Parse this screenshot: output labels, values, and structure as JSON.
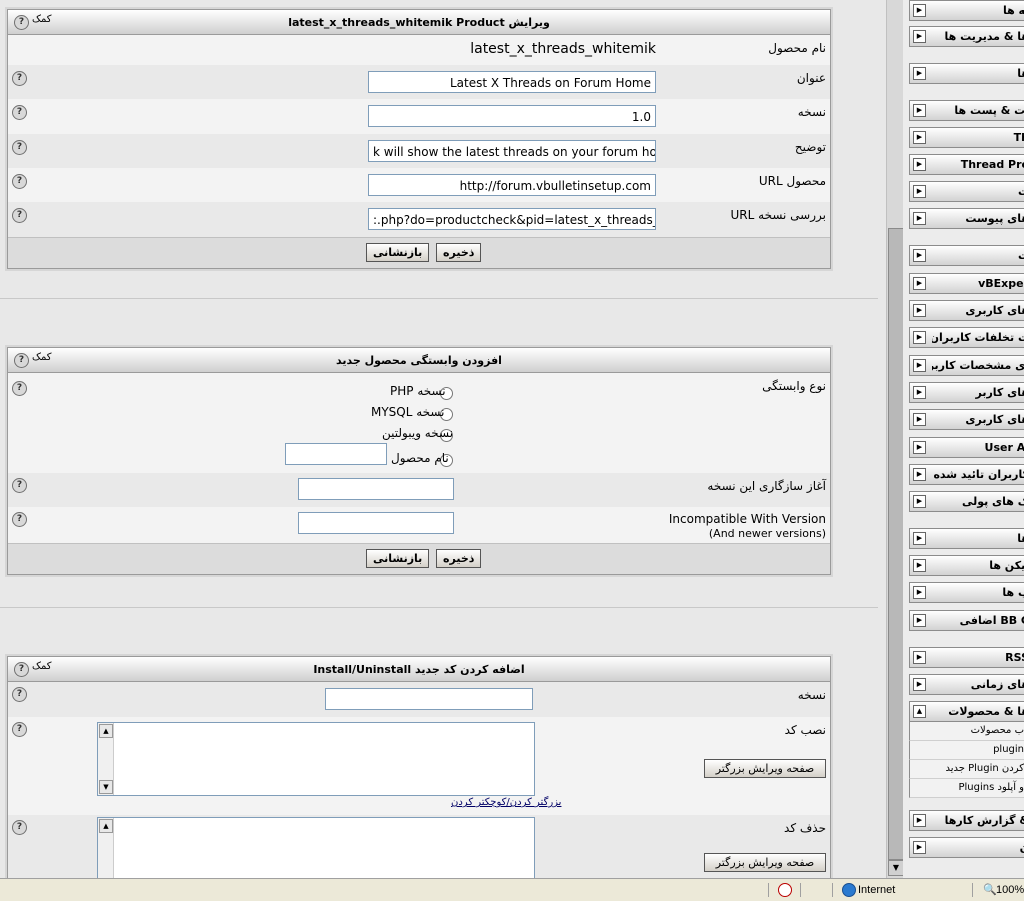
{
  "edit_product": {
    "title": "ویرایش latest_x_threads_whitemik Product",
    "help": "کمک",
    "rows": [
      {
        "label": "نام محصول",
        "value": "latest_x_threads_whitemik"
      },
      {
        "label": "عنوان",
        "value": "Latest X Threads on Forum Home"
      },
      {
        "label": "نسخه",
        "value": "1.0"
      },
      {
        "label": "توضیح",
        "value": "k will show the latest threads on your forum home page"
      },
      {
        "label": "محصول URL",
        "value": "http://forum.vbulletinsetup.com"
      },
      {
        "label": "بررسی نسخه URL",
        "value": ":.php?do=productcheck&pid=latest_x_threads_whitemik"
      }
    ],
    "save": "ذخیره",
    "reset": "بازنشانی"
  },
  "dependency": {
    "title": "افزودن وابستگی محصول جدید",
    "help": "کمک",
    "type_label": "نوع وابستگی",
    "options": [
      "نسخه PHP",
      "نسخه MYSQL",
      "نسخه ویبولتین",
      "نام محصول"
    ],
    "min_label": "آغاز سازگاری این نسخه",
    "incompat_label": "Incompatible With Version",
    "incompat_sub": "(And newer versions)",
    "save": "ذخیره",
    "reset": "بازنشانی"
  },
  "install": {
    "title": "اضافه کردن کد جدید Install/Uninstall",
    "help": "کمک",
    "version_label": "نسخه",
    "install_label": "نصب کد",
    "uninstall_label": "حذف کد",
    "large_edit": "صفحه ویرایش بزرگتر",
    "resize_link": "بزرگتر کردن/کوچکتر کردن"
  },
  "sidebar": {
    "items": [
      {
        "label": "ـه ها"
      },
      {
        "label": "ها & مدیریت ها"
      },
      {
        "label": "ها"
      },
      {
        "label": "ات & پست ها"
      },
      {
        "label": "Th"
      },
      {
        "label": "Thread Pre"
      },
      {
        "label": "ت"
      },
      {
        "label": "های پیوست"
      },
      {
        "label": "ت"
      },
      {
        "label": "vBExper"
      },
      {
        "label": "های کاربری"
      },
      {
        "label": "ت تخلفات کاربران"
      },
      {
        "label": "ای مشخصات کاربر"
      },
      {
        "label": "های کاربر"
      },
      {
        "label": "های کاربری"
      },
      {
        "label": "User Al"
      },
      {
        "label": "کاربران تائید شده"
      },
      {
        "label": "ک های پولی"
      },
      {
        "label": "ها"
      },
      {
        "label": "آیکن ها"
      },
      {
        "label": "ب ها"
      },
      {
        "label": "BB C اضافی"
      },
      {
        "label": "RSS"
      },
      {
        "label": "های زمانی"
      },
      {
        "label": "ها & محصولات"
      },
      {
        "label": "& گزارش کارها"
      },
      {
        "label": "ن"
      }
    ],
    "subitems": [
      "ب محصولات",
      "plugin",
      "کردن Plugin جدید",
      "و آپلود Plugins"
    ]
  },
  "statusbar": {
    "zone": "Internet",
    "zoom": "100%"
  }
}
